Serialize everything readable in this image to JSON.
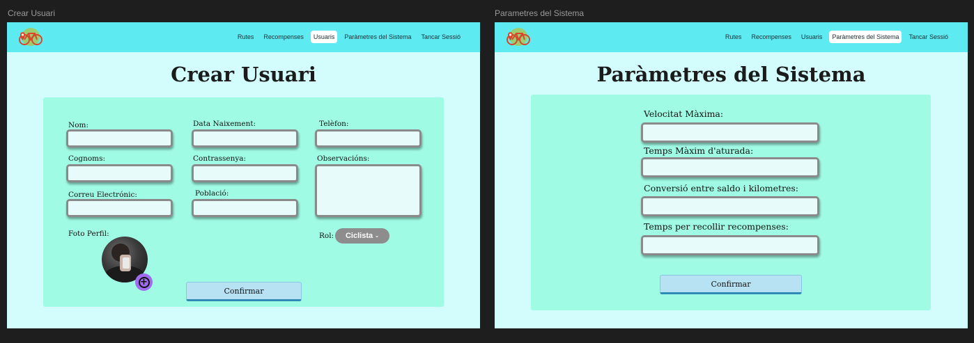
{
  "frames": {
    "left": {
      "label": "Crear Usuari"
    },
    "right": {
      "label": "Parametres del Sistema"
    }
  },
  "nav": {
    "items": [
      "Rutes",
      "Recompenses",
      "Usuaris",
      "Paràmetres del Sistema",
      "Tancar Sessió"
    ],
    "active_left": "Usuaris",
    "active_right": "Paràmetres del Sistema"
  },
  "create_user": {
    "title": "Crear Usuari",
    "fields": {
      "nom": {
        "label": "Nom:",
        "value": ""
      },
      "data_naixement": {
        "label": "Data Naixement:",
        "value": ""
      },
      "telefon": {
        "label": "Telèfon:",
        "value": ""
      },
      "cognoms": {
        "label": "Cognoms:",
        "value": ""
      },
      "contrassenya": {
        "label": "Contrassenya:",
        "value": ""
      },
      "observacions": {
        "label": "Observacións:",
        "value": ""
      },
      "correu": {
        "label": "Correu Electrónic:",
        "value": ""
      },
      "poblacio": {
        "label": "Població:",
        "value": ""
      }
    },
    "photo_label": "Foto Perfil:",
    "role_label": "Rol:",
    "role_value": "Ciclista",
    "confirm_label": "Confirmar"
  },
  "system_params": {
    "title": "Paràmetres del Sistema",
    "fields": [
      {
        "label": "Velocitat Màxima:",
        "value": ""
      },
      {
        "label": "Temps Màxim d'aturada:",
        "value": ""
      },
      {
        "label": "Conversió entre saldo i kilometres:",
        "value": ""
      },
      {
        "label": "Temps per recollir recompenses:",
        "value": ""
      }
    ],
    "confirm_label": "Confirmar"
  },
  "colors": {
    "canvas": "#1e1e1e",
    "navbar": "#5eeaf1",
    "page_bg": "#d3fcfc",
    "panel": "#a0fbe4",
    "role_pill": "#8d8d8d",
    "plus_button": "#9f6cf0",
    "confirm_button": "#b7e2f3"
  },
  "icons": {
    "logo": "bicycle-logo-icon",
    "add_photo": "plus-circle-icon",
    "role_dropdown": "chevron-down-icon"
  }
}
